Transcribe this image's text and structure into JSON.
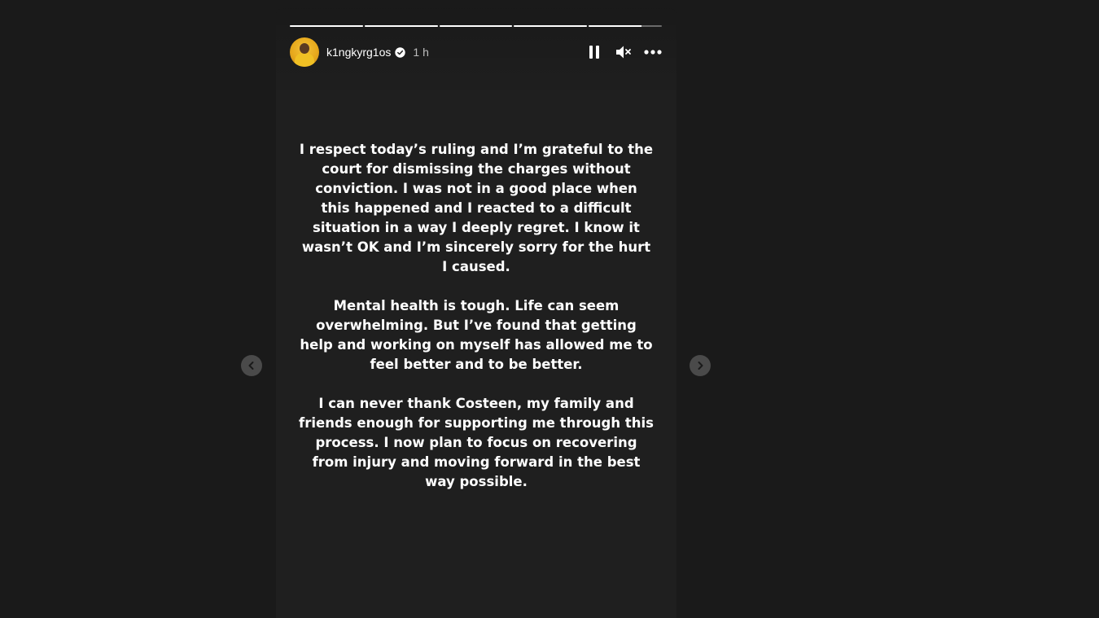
{
  "story": {
    "progress_segments": [
      {
        "filled": 1.0
      },
      {
        "filled": 1.0
      },
      {
        "filled": 1.0
      },
      {
        "filled": 1.0
      },
      {
        "filled": 0.72
      }
    ],
    "author": {
      "username": "k1ngkyrg1os",
      "verified": true,
      "time_ago": "1 h"
    },
    "controls": {
      "pause_icon": "pause-icon",
      "mute_icon": "muted-speaker-icon",
      "more_icon": "more-options-icon"
    },
    "message_paragraphs": [
      "I respect today’s ruling and I’m grateful to the court for dismissing the charges without conviction. I was not in a good place when this happened and I reacted to a difficult situation in a way I deeply regret. I know it wasn’t OK and I’m sincerely sorry for the hurt I caused.",
      "Mental health is tough. Life can seem overwhelming. But I’ve found that getting help and working on myself has allowed me to feel better and to be better.",
      "I can never thank Costeen, my family and friends enough for supporting me through this process. I now plan to focus on recovering from injury and moving forward in the best way possible."
    ]
  },
  "navigation": {
    "prev_icon": "chevron-left-icon",
    "next_icon": "chevron-right-icon"
  },
  "colors": {
    "background": "#1a1a1a",
    "story_background": "#1f1f1f",
    "text": "#ffffff",
    "verified_badge": "#ffffff"
  }
}
